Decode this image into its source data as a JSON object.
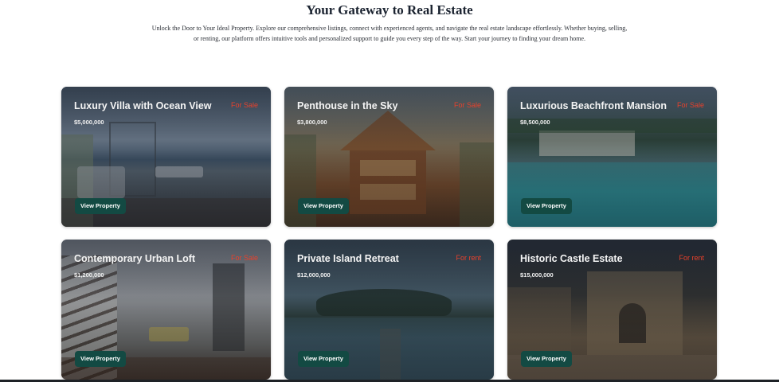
{
  "header": {
    "title": "Your Gateway to Real Estate",
    "subtitle": "Unlock the Door to Your Ideal Property. Explore our comprehensive listings, connect with experienced agents, and navigate the real estate landscape effortlessly. Whether buying, selling, or renting, our platform offers intuitive tools and personalized support to guide you every step of the way. Start your journey to finding your dream home."
  },
  "listings": [
    {
      "name": "Luxury Villa with Ocean View",
      "price": "$5,000,000",
      "status": "For Sale",
      "button": "View Property"
    },
    {
      "name": "Penthouse in the Sky",
      "price": "$3,800,000",
      "status": "For Sale",
      "button": "View Property"
    },
    {
      "name": "Luxurious Beachfront Mansion",
      "price": "$8,500,000",
      "status": "For Sale",
      "button": "View Property"
    },
    {
      "name": "Contemporary Urban Loft",
      "price": "$1,200,000",
      "status": "For Sale",
      "button": "View Property"
    },
    {
      "name": "Private Island Retreat",
      "price": "$12,000,000",
      "status": "For rent",
      "button": "View Property"
    },
    {
      "name": "Historic Castle Estate",
      "price": "$15,000,000",
      "status": "For rent",
      "button": "View Property"
    }
  ],
  "colors": {
    "status": "#e8412c",
    "button_bg": "#134a43",
    "title": "#1b2330"
  }
}
